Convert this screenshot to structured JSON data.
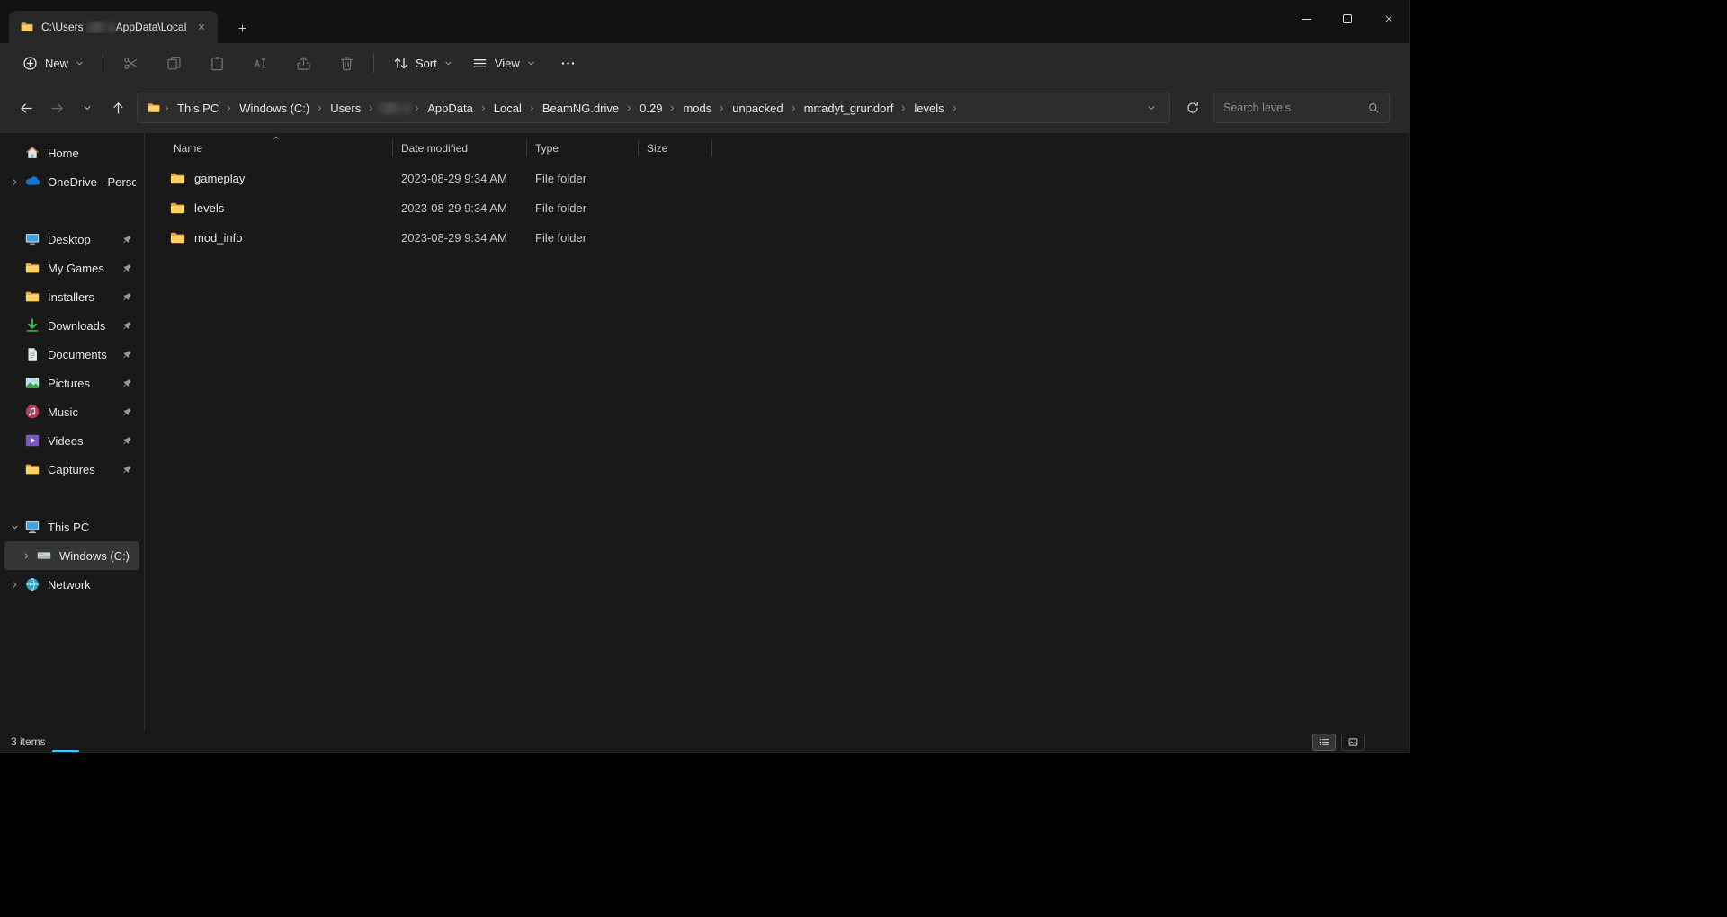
{
  "window": {
    "tab": {
      "title_prefix": "C:\\Users",
      "title_suffix": "AppData\\Local"
    }
  },
  "toolbar": {
    "new_label": "New",
    "actions": [
      {
        "name": "cut"
      },
      {
        "name": "copy"
      },
      {
        "name": "paste"
      },
      {
        "name": "rename"
      },
      {
        "name": "share"
      },
      {
        "name": "delete"
      }
    ],
    "sort_label": "Sort",
    "view_label": "View"
  },
  "address": {
    "breadcrumbs": [
      {
        "label": "This PC"
      },
      {
        "label": "Windows (C:)"
      },
      {
        "label": "Users"
      },
      {
        "label": "",
        "redacted": true
      },
      {
        "label": "AppData"
      },
      {
        "label": "Local"
      },
      {
        "label": "BeamNG.drive"
      },
      {
        "label": "0.29"
      },
      {
        "label": "mods"
      },
      {
        "label": "unpacked"
      },
      {
        "label": "mrradyt_grundorf"
      },
      {
        "label": "levels"
      }
    ],
    "search_placeholder": "Search levels"
  },
  "sidebar": {
    "sections": [
      {
        "items": [
          {
            "label": "Home",
            "icon": "home"
          },
          {
            "label": "OneDrive - Persona",
            "icon": "onedrive",
            "chevron": "right"
          }
        ]
      },
      {
        "items": [
          {
            "label": "Desktop",
            "icon": "desktop",
            "pinned": true
          },
          {
            "label": "My Games",
            "icon": "folder",
            "pinned": true
          },
          {
            "label": "Installers",
            "icon": "folder",
            "pinned": true
          },
          {
            "label": "Downloads",
            "icon": "downloads",
            "pinned": true
          },
          {
            "label": "Documents",
            "icon": "documents",
            "pinned": true
          },
          {
            "label": "Pictures",
            "icon": "pictures",
            "pinned": true
          },
          {
            "label": "Music",
            "icon": "music",
            "pinned": true
          },
          {
            "label": "Videos",
            "icon": "videos",
            "pinned": true
          },
          {
            "label": "Captures",
            "icon": "folder",
            "pinned": true
          }
        ]
      },
      {
        "items": [
          {
            "label": "This PC",
            "icon": "thispc",
            "chevron": "down"
          },
          {
            "label": "Windows (C:)",
            "icon": "drive",
            "chevron": "right",
            "indent": true,
            "selected": true
          },
          {
            "label": "Network",
            "icon": "network",
            "chevron": "right"
          }
        ]
      }
    ]
  },
  "file_list": {
    "columns": [
      "Name",
      "Date modified",
      "Type",
      "Size"
    ],
    "sort": {
      "column": "Name",
      "direction": "asc"
    },
    "rows": [
      {
        "name": "gameplay",
        "icon": "folder",
        "date_modified": "2023-08-29 9:34 AM",
        "type": "File folder",
        "size": ""
      },
      {
        "name": "levels",
        "icon": "folder",
        "date_modified": "2023-08-29 9:34 AM",
        "type": "File folder",
        "size": ""
      },
      {
        "name": "mod_info",
        "icon": "folder",
        "date_modified": "2023-08-29 9:34 AM",
        "type": "File folder",
        "size": ""
      }
    ]
  },
  "status": {
    "count": "3 items"
  }
}
